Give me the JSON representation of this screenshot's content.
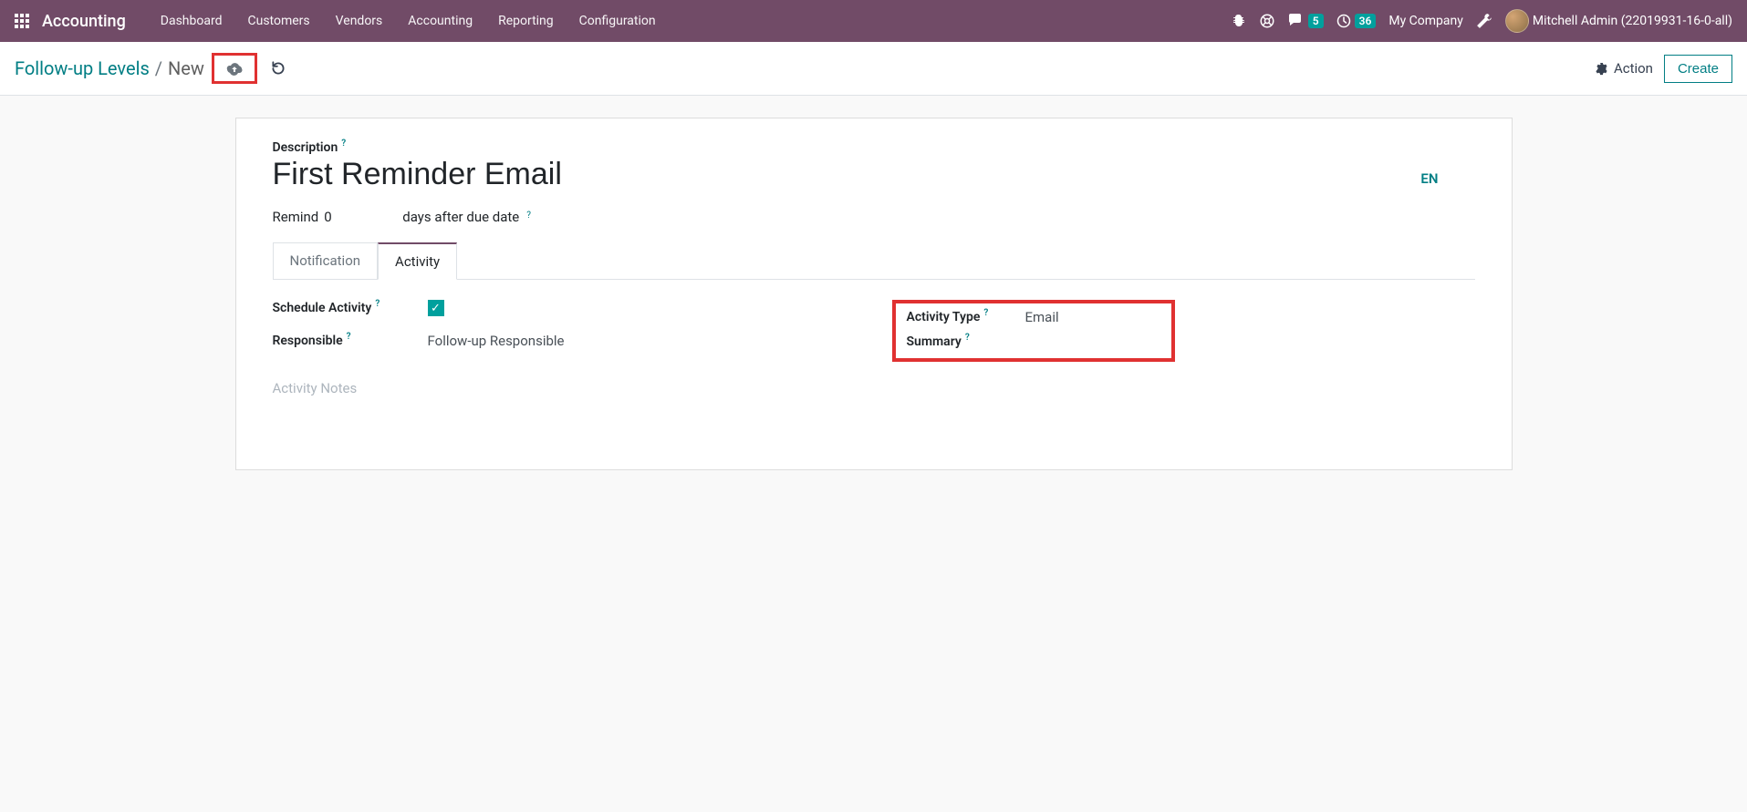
{
  "navbar": {
    "brand": "Accounting",
    "menu": [
      "Dashboard",
      "Customers",
      "Vendors",
      "Accounting",
      "Reporting",
      "Configuration"
    ],
    "messages_count": "5",
    "activities_count": "36",
    "company": "My Company",
    "user": "Mitchell Admin (22019931-16-0-all)"
  },
  "breadcrumb": {
    "parent": "Follow-up Levels",
    "current": "New"
  },
  "controls": {
    "action": "Action",
    "create": "Create"
  },
  "form": {
    "description_label": "Description",
    "title": "First Reminder Email",
    "lang": "EN",
    "remind_prefix": "Remind",
    "remind_value": "0",
    "remind_suffix": "days after due date",
    "tabs": {
      "notification": "Notification",
      "activity": "Activity"
    },
    "schedule_activity_label": "Schedule Activity",
    "schedule_activity_checked": true,
    "responsible_label": "Responsible",
    "responsible_value": "Follow-up Responsible",
    "activity_type_label": "Activity Type",
    "activity_type_value": "Email",
    "summary_label": "Summary",
    "summary_value": "",
    "activity_notes_placeholder": "Activity Notes"
  }
}
